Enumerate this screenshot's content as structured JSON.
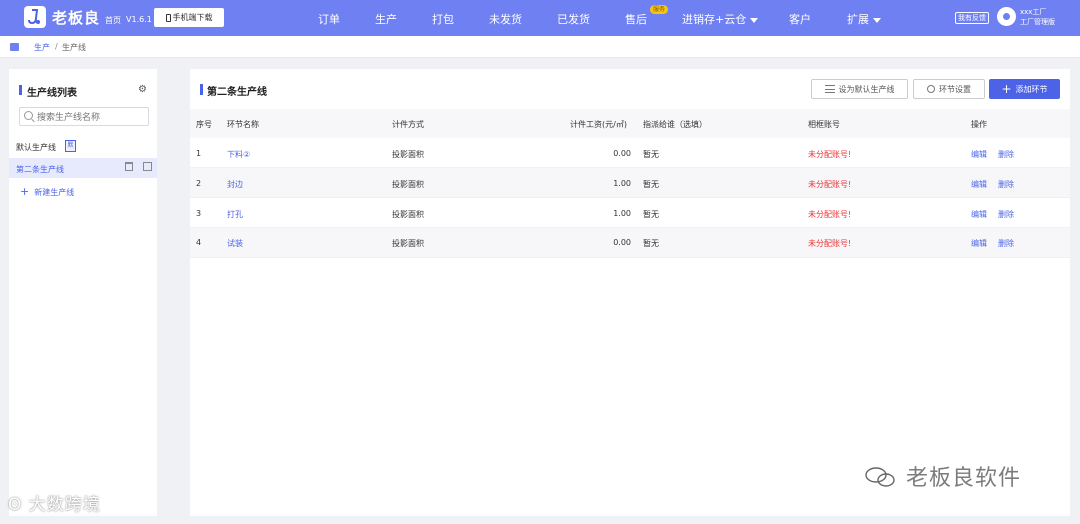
{
  "header": {
    "brand": "老板良",
    "home_link": "首页",
    "version": "V1.6.1",
    "mobile_button": "手机端下载",
    "nav": [
      {
        "label": "订单"
      },
      {
        "label": "生产"
      },
      {
        "label": "打包"
      },
      {
        "label": "未发货"
      },
      {
        "label": "已发货"
      },
      {
        "label": "售后",
        "badge": "服务"
      },
      {
        "label": "进销存+云仓",
        "dropdown": true
      },
      {
        "label": "客户"
      },
      {
        "label": "扩展",
        "dropdown": true
      }
    ],
    "feedback": "我有反馈",
    "user_name": "xxx工厂",
    "user_role": "工厂管理版",
    "bg_color": "#6f80f2"
  },
  "breadcrumb": {
    "items": [
      "生产",
      "生产线"
    ],
    "separator": "/"
  },
  "sidebar": {
    "title": "生产线列表",
    "search_placeholder": "搜索生产线名称",
    "default_label": "默认生产线",
    "default_badge": "默",
    "active_item": "第二条生产线",
    "add_label": "新建生产线"
  },
  "main": {
    "title": "第二条生产线",
    "buttons": {
      "set_default": "设为默认生产线",
      "settings": "环节设置",
      "add": "添加环节"
    },
    "columns": [
      "序号",
      "环节名称",
      "计件方式",
      "计件工资(元/㎡)",
      "指派给谁（选填）",
      "相框账号",
      "操作"
    ],
    "rows": [
      {
        "no": "1",
        "name": "下料②",
        "method": "投影面积",
        "wage": "0.00",
        "assignee": "暂无",
        "account": "未分配账号!",
        "edit": "编辑",
        "delete": "删除"
      },
      {
        "no": "2",
        "name": "封边",
        "method": "投影面积",
        "wage": "1.00",
        "assignee": "暂无",
        "account": "未分配账号!",
        "edit": "编辑",
        "delete": "删除"
      },
      {
        "no": "3",
        "name": "打孔",
        "method": "投影面积",
        "wage": "1.00",
        "assignee": "暂无",
        "account": "未分配账号!",
        "edit": "编辑",
        "delete": "删除"
      },
      {
        "no": "4",
        "name": "试装",
        "method": "投影面积",
        "wage": "0.00",
        "assignee": "暂无",
        "account": "未分配账号!",
        "edit": "编辑",
        "delete": "删除"
      }
    ]
  },
  "watermarks": {
    "right": "老板良软件",
    "left": "大数跨境"
  },
  "colors": {
    "accent": "#4c63e8",
    "warn": "#e33333"
  }
}
